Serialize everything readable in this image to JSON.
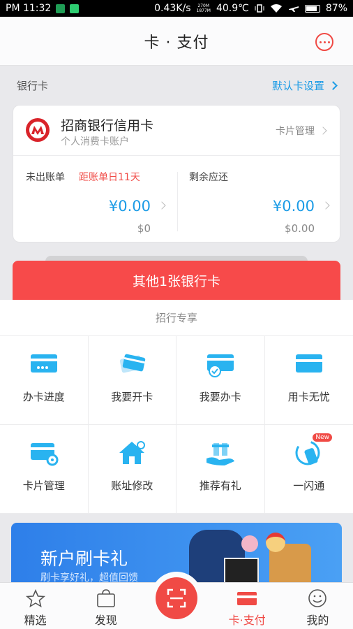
{
  "status_bar": {
    "time": "PM 11:32",
    "net_speed": "0.43K/s",
    "net_detail_top": "270M",
    "net_detail_bottom": "1877M",
    "temperature": "40.9℃",
    "battery": "87%",
    "battery_level": 0.87
  },
  "header": {
    "title": "卡 · 支付",
    "message_icon": "chat-bubble-icon"
  },
  "section": {
    "label": "银行卡",
    "default_card_link": "默认卡设置"
  },
  "card": {
    "bank_name": "招商银行信用卡",
    "account_type": "个人消费卡账户",
    "manage_label": "卡片管理",
    "unbilled_label": "未出账单",
    "due_hint": "距账单日11天",
    "unbilled_amount": "¥0.00",
    "unbilled_usd": "$0",
    "remaining_label": "剩余应还",
    "remaining_amount": "¥0.00",
    "remaining_usd": "$0.00"
  },
  "other_cards_button": "其他1张银行卡",
  "exclusive": {
    "title": "招行专享",
    "items": [
      {
        "label": "办卡进度",
        "icon": "card-progress-icon"
      },
      {
        "label": "我要开卡",
        "icon": "card-activate-icon"
      },
      {
        "label": "我要办卡",
        "icon": "card-apply-icon"
      },
      {
        "label": "用卡无忧",
        "icon": "card-worry-free-icon"
      },
      {
        "label": "卡片管理",
        "icon": "card-settings-icon"
      },
      {
        "label": "账址修改",
        "icon": "home-settings-icon"
      },
      {
        "label": "推荐有礼",
        "icon": "gift-hand-icon"
      },
      {
        "label": "一闪通",
        "icon": "nfc-phone-icon",
        "badge": "New"
      }
    ]
  },
  "banner": {
    "headline": "新户刷卡礼",
    "subline": "刷卡享好礼，超值回馈"
  },
  "tabs": [
    {
      "label": "精选",
      "icon": "star-icon"
    },
    {
      "label": "发现",
      "icon": "bag-icon"
    },
    {
      "label": "卡·支付",
      "icon": "card-icon",
      "active": true
    },
    {
      "label": "我的",
      "icon": "smile-icon"
    }
  ],
  "scan_icon": "scan-icon",
  "colors": {
    "accent_red": "#f04a45",
    "accent_blue": "#1a9be6",
    "icon_blue": "#29b3f0"
  }
}
